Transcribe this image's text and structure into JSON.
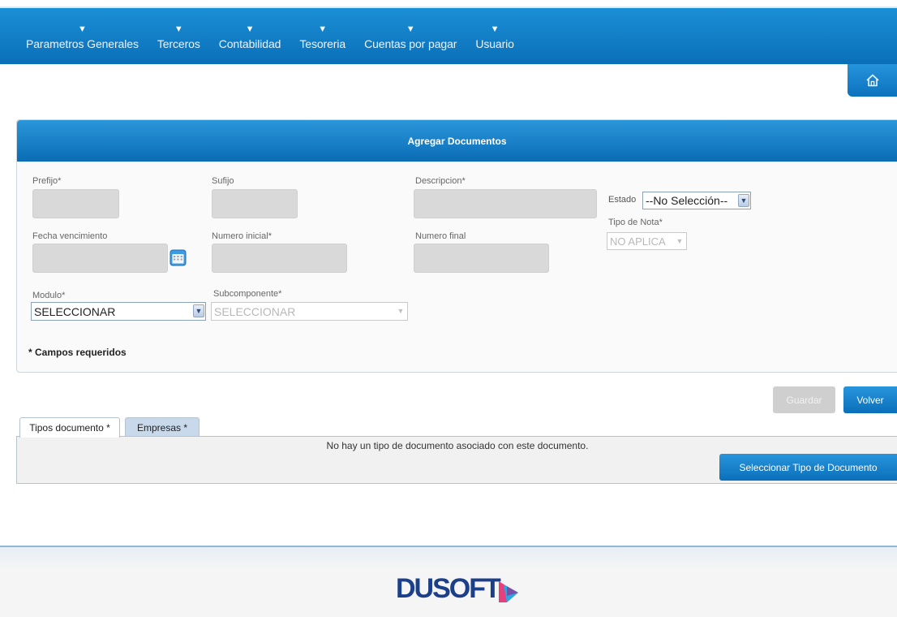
{
  "nav": {
    "items": [
      {
        "label": "Parametros Generales"
      },
      {
        "label": "Terceros"
      },
      {
        "label": "Contabilidad"
      },
      {
        "label": "Tesoreria"
      },
      {
        "label": "Cuentas por pagar"
      },
      {
        "label": "Usuario"
      }
    ],
    "arrow": "▼"
  },
  "panel": {
    "title": "Agregar Documentos",
    "prefijo_label": "Prefijo*",
    "sufijo_label": "Sufijo",
    "descripcion_label": "Descripcion*",
    "estado_label": "Estado",
    "estado_value": "--No Selección--",
    "tipo_nota_label": "Tipo de Nota*",
    "tipo_nota_value": "NO APLICA",
    "fecha_label": "Fecha vencimiento",
    "numero_inicial_label": "Numero inicial*",
    "numero_final_label": "Numero final",
    "modulo_label": "Modulo*",
    "modulo_value": "SELECCIONAR",
    "subcomponente_label": "Subcomponente*",
    "subcomponente_value": "SELECCIONAR",
    "required_note": "* Campos requeridos"
  },
  "actions": {
    "guardar": "Guardar",
    "volver": "Volver"
  },
  "tabs": [
    {
      "label": "Tipos documento *"
    },
    {
      "label": "Empresas *"
    }
  ],
  "tab_content": {
    "empty_message": "No hay un tipo de documento asociado con este documento.",
    "select_button": "Seleccionar Tipo de Documento"
  },
  "footer": {
    "logo": "DUSOFT"
  },
  "colors": {
    "primary": "#0a6fb8",
    "field_bg": "#d9d9d9",
    "disabled_btn": "#cfcfcf"
  }
}
